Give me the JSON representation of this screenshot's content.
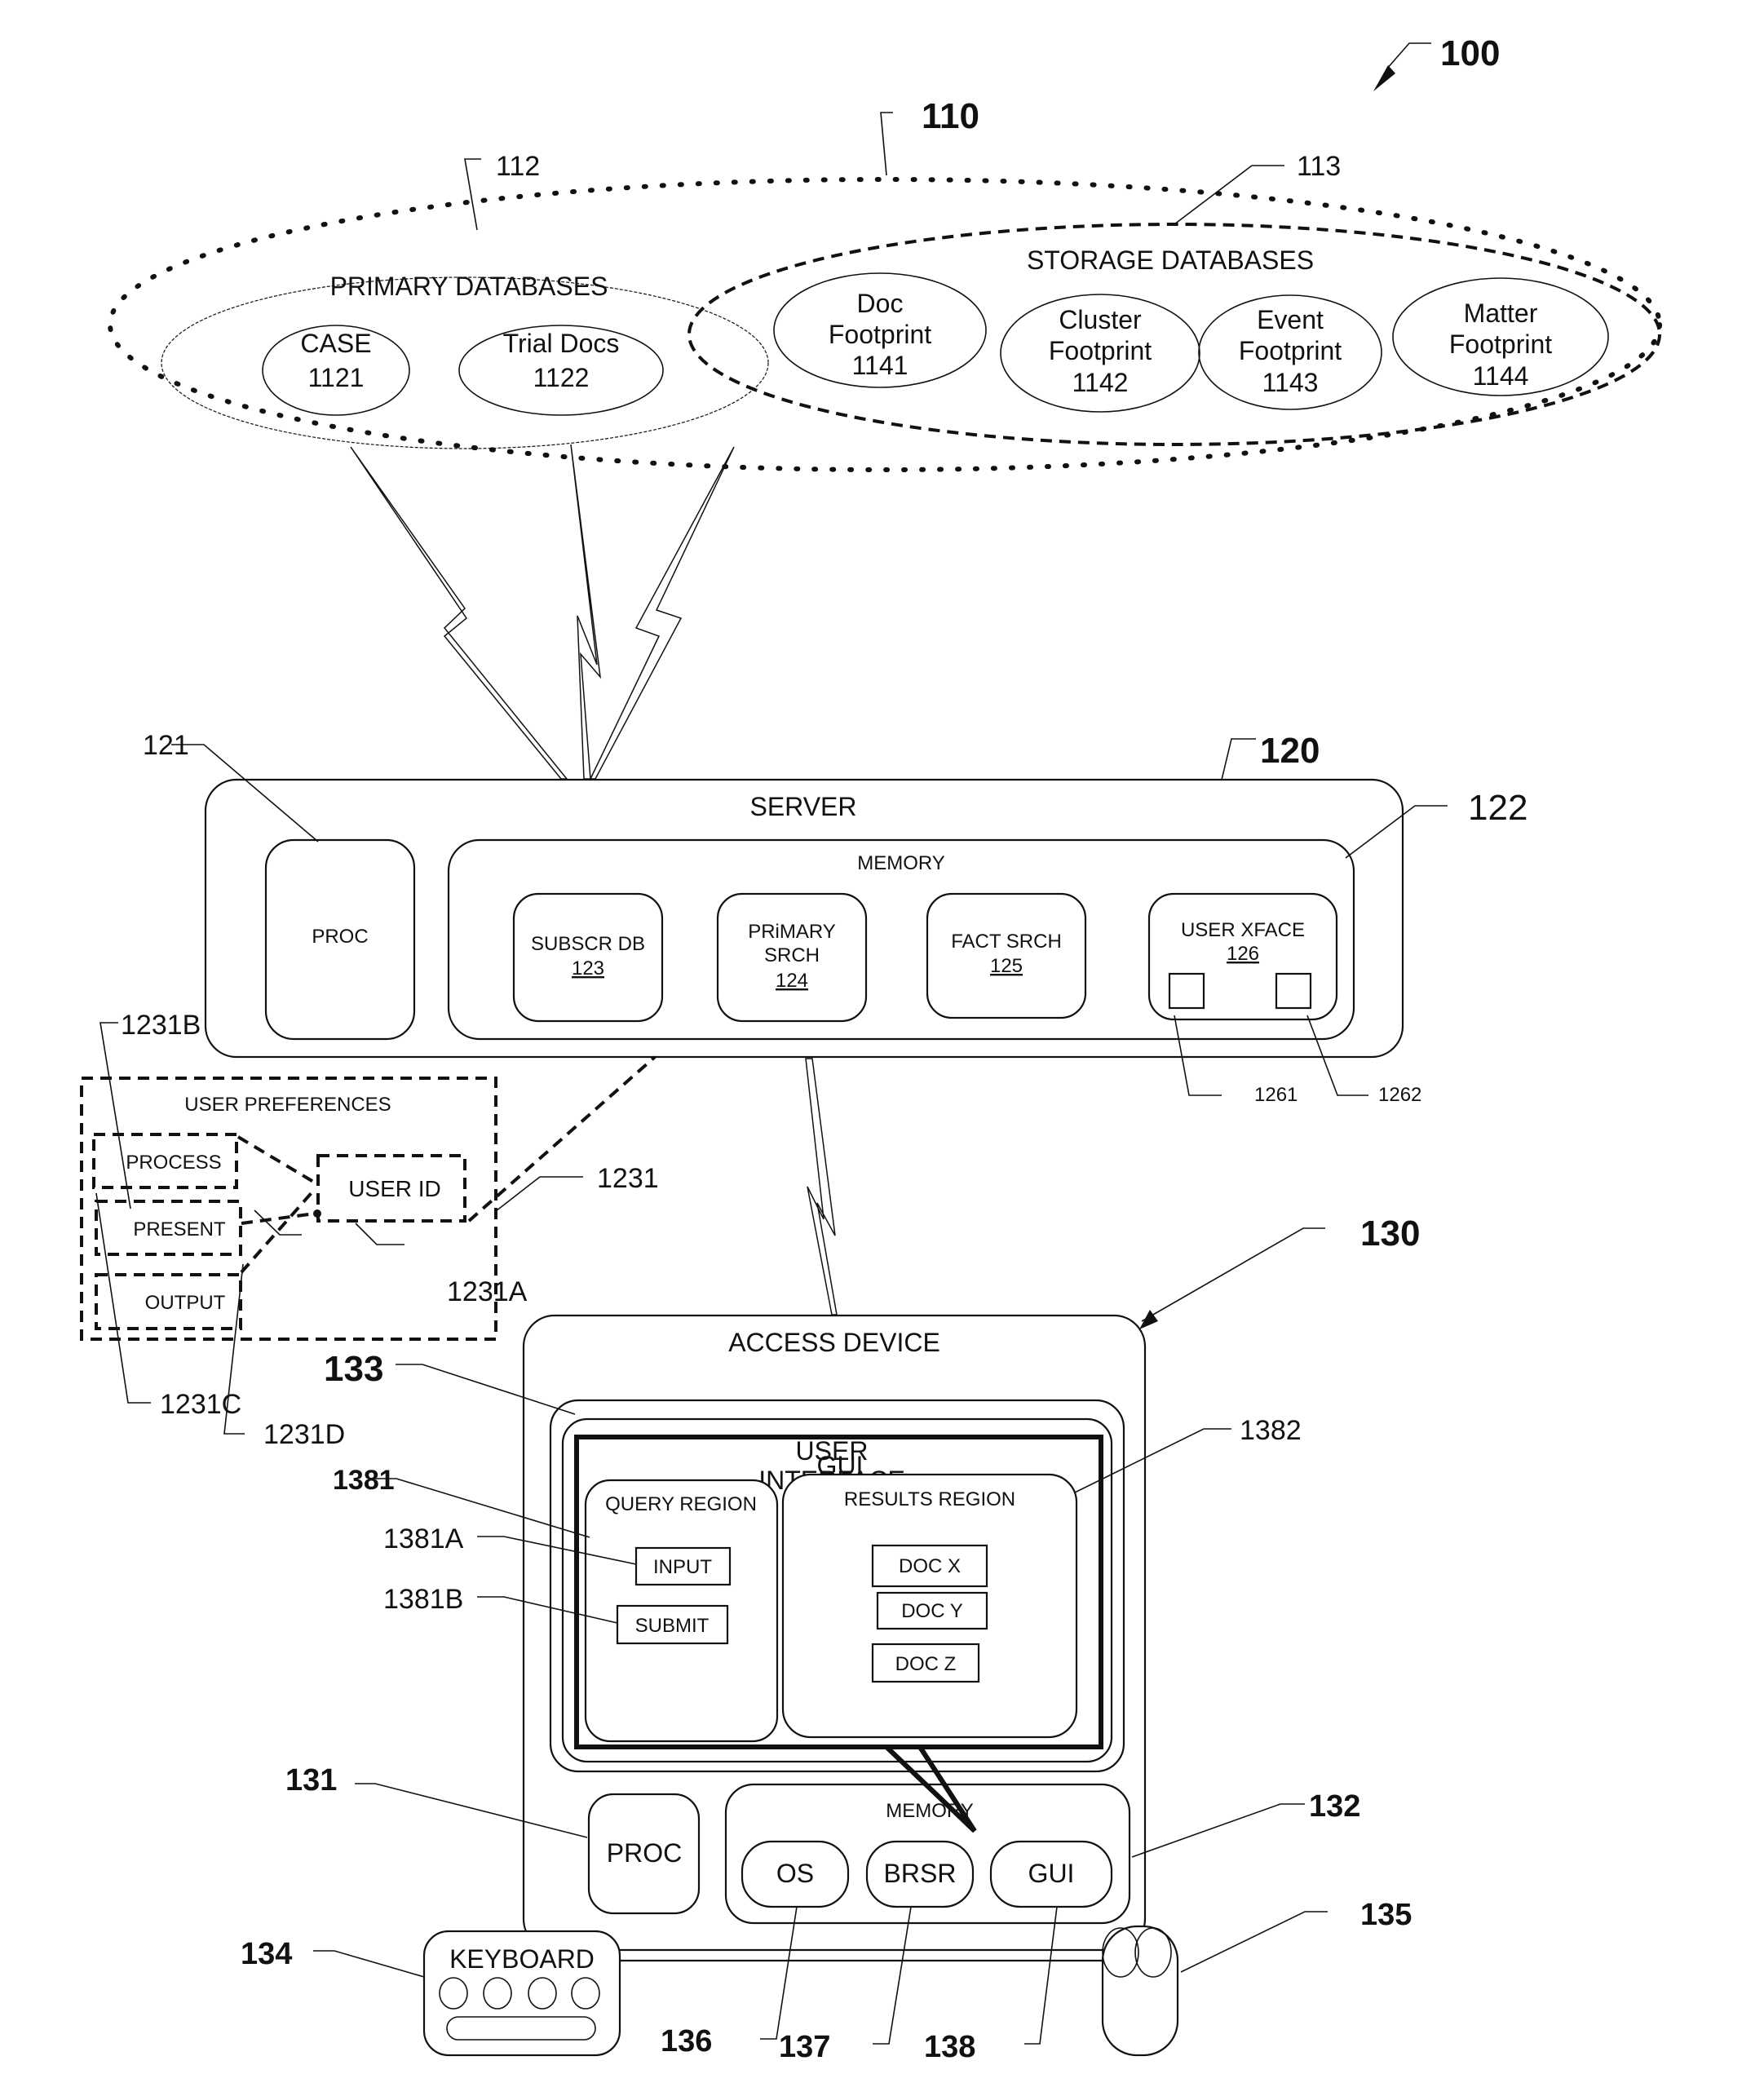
{
  "figure_ref": "100",
  "network": {
    "ref": "110",
    "primary": {
      "ref": "112",
      "title": "PRIMARY DATABASES",
      "items": [
        {
          "name": "CASE",
          "ref": "1121"
        },
        {
          "name": "Trial Docs",
          "ref": "1122"
        }
      ]
    },
    "storage": {
      "ref": "113",
      "title": "STORAGE DATABASES",
      "items": [
        {
          "line1": "Doc",
          "line2": "Footprint",
          "ref": "1141"
        },
        {
          "line1": "Cluster",
          "line2": "Footprint",
          "ref": "1142"
        },
        {
          "line1": "Event",
          "line2": "Footprint",
          "ref": "1143"
        },
        {
          "line1": "Matter",
          "line2": "Footprint",
          "ref": "1144"
        }
      ]
    }
  },
  "server": {
    "ref": "120",
    "title": "SERVER",
    "proc": {
      "ref": "121",
      "label": "PROC"
    },
    "memory": {
      "ref": "122",
      "title": "MEMORY",
      "modules": [
        {
          "line1": "SUBSCR DB",
          "line2": "",
          "ref": "123"
        },
        {
          "line1": "PRiMARY",
          "line2": "SRCH",
          "ref": "124"
        },
        {
          "line1": "FACT SRCH",
          "line2": "",
          "ref": "125"
        },
        {
          "line1": "USER XFACE",
          "line2": "",
          "ref": "126"
        }
      ],
      "xface_subrefs": [
        "1261",
        "1262"
      ]
    }
  },
  "user_prefs": {
    "ref": "1231",
    "title": "USER PREFERENCES",
    "user_id": {
      "label": "USER ID",
      "ref": "1231A"
    },
    "items": [
      {
        "label": "PROCESS",
        "ref": "1231B"
      },
      {
        "label": "PRESENT",
        "ref": "1231C"
      },
      {
        "label": "OUTPUT",
        "ref": "1231D"
      }
    ]
  },
  "access_device": {
    "ref": "130",
    "title": "ACCESS DEVICE",
    "display_ref": "133",
    "gui": {
      "title_line1": "USER",
      "title_line2": "INTERFACE",
      "overlap_text": "GUI",
      "query_region": {
        "ref": "1381",
        "title": "QUERY REGION",
        "input": {
          "label": "INPUT",
          "ref": "1381A"
        },
        "submit": {
          "label": "SUBMIT",
          "ref": "1381B"
        }
      },
      "results_region": {
        "ref": "1382",
        "title": "RESULTS REGION",
        "docs": [
          "DOC X",
          "DOC Y",
          "DOC Z"
        ]
      }
    },
    "proc": {
      "ref": "131",
      "label": "PROC"
    },
    "memory": {
      "ref": "132",
      "title": "MEMORY",
      "modules": [
        {
          "label": "OS",
          "ref": "136"
        },
        {
          "label": "BRSR",
          "ref": "137"
        },
        {
          "label": "GUI",
          "ref": "138"
        }
      ]
    },
    "keyboard": {
      "ref": "134",
      "label": "KEYBOARD"
    },
    "mouse": {
      "ref": "135"
    }
  }
}
